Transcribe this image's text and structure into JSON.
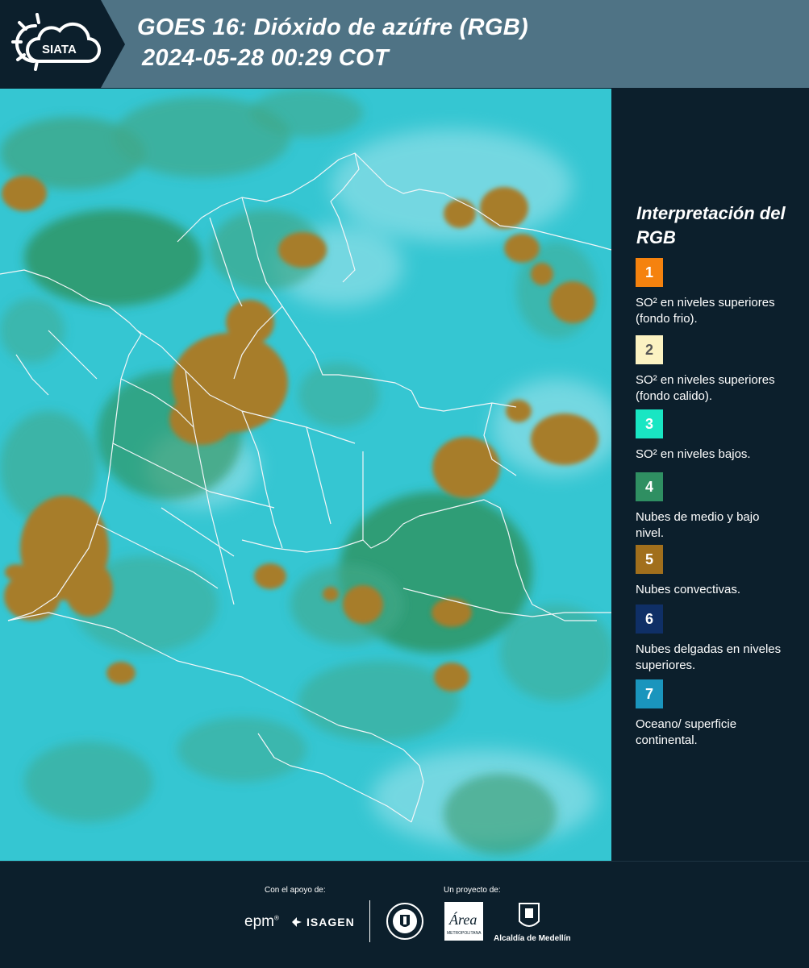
{
  "header": {
    "logo_text": "SIATA",
    "title_line1": "GOES 16: Dióxido de azúfre (RGB)",
    "title_line2": "2024-05-28 00:29 COT",
    "band_color": "#4f7385",
    "accent_color": "#0c1f2c"
  },
  "map": {
    "description_icon": "satellite-rgb-image",
    "colors": {
      "ocean": "#35c6d2",
      "haze": "#a8e6ee",
      "low_cloud": "#3fa88a",
      "mid_cloud": "#2f8f55",
      "convective": "#a77d2b",
      "border": "#f2f6f8"
    }
  },
  "legend": {
    "title": "Interpretación del RGB",
    "items": [
      {
        "number": "1",
        "label": "SO² en niveles superiores (fondo frio).",
        "color": "#f5820e",
        "text_color": "#ffffff"
      },
      {
        "number": "2",
        "label": "SO² en niveles superiores (fondo calido).",
        "color": "#fbf2c2",
        "text_color": "#555555"
      },
      {
        "number": "3",
        "label": "SO² en niveles bajos.",
        "color": "#19e6c3",
        "text_color": "#ffffff"
      },
      {
        "number": "4",
        "label": "Nubes de medio y bajo nivel.",
        "color": "#2f8f62",
        "text_color": "#ffffff"
      },
      {
        "number": "5",
        "label": "Nubes convectivas.",
        "color": "#a16f1c",
        "text_color": "#ffffff"
      },
      {
        "number": "6",
        "label": "Nubes delgadas en niveles superiores.",
        "color": "#0f2f66",
        "text_color": "#ffffff"
      },
      {
        "number": "7",
        "label": "Oceano/ superficie continental.",
        "color": "#1a95bd",
        "text_color": "#ffffff"
      }
    ]
  },
  "footer": {
    "support_label": "Con el apoyo de:",
    "project_label": "Un proyecto de:",
    "epm": "epm",
    "isagen": "ISAGEN",
    "area_metropolitana": "Área",
    "area_sub": "METROPOLITANA",
    "alcaldia": "Alcaldía de Medellín"
  }
}
